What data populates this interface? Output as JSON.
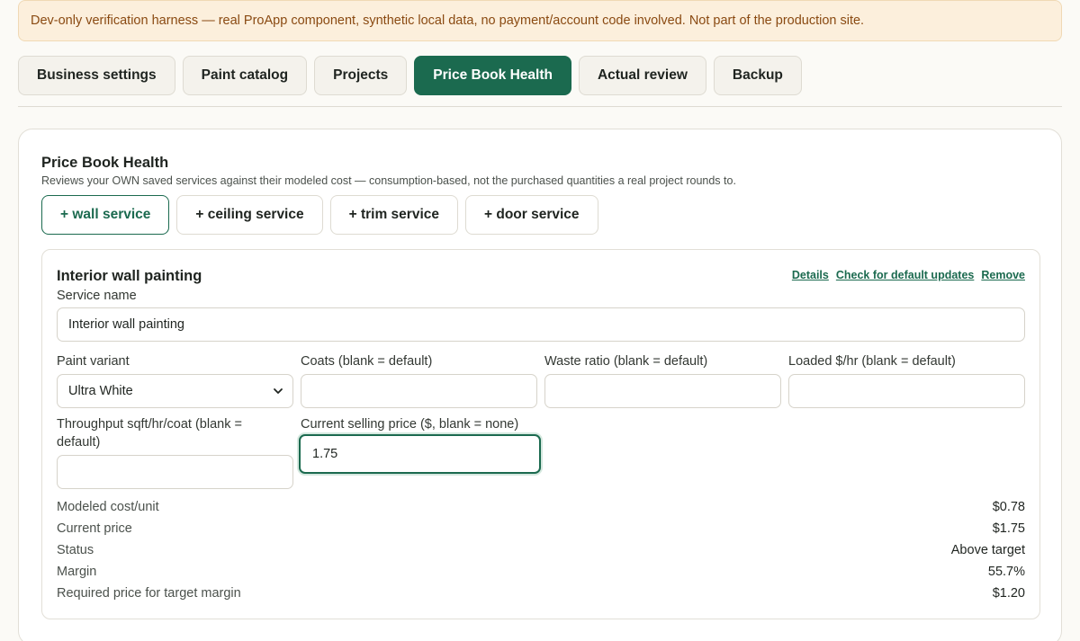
{
  "banner": {
    "text": "Dev-only verification harness — real ProApp component, synthetic local data, no payment/account code involved. Not part of the production site."
  },
  "tabs": [
    {
      "label": "Business settings",
      "active": false
    },
    {
      "label": "Paint catalog",
      "active": false
    },
    {
      "label": "Projects",
      "active": false
    },
    {
      "label": "Price Book Health",
      "active": true
    },
    {
      "label": "Actual review",
      "active": false
    },
    {
      "label": "Backup",
      "active": false
    }
  ],
  "card": {
    "title": "Price Book Health",
    "subtitle": "Reviews your OWN saved services against their modeled cost — consumption-based, not the purchased quantities a real project rounds to.",
    "add_buttons": [
      "+ wall service",
      "+ ceiling service",
      "+ trim service",
      "+ door service"
    ]
  },
  "service": {
    "title": "Interior wall painting",
    "links": {
      "details": "Details",
      "check_updates": "Check for default updates",
      "remove": "Remove"
    },
    "name_label": "Service name",
    "name_value": "Interior wall painting",
    "paint_variant_label": "Paint variant",
    "paint_variant_value": "Ultra White",
    "coats_label": "Coats (blank = default)",
    "coats_value": "",
    "waste_label": "Waste ratio (blank = default)",
    "waste_value": "",
    "loaded_label": "Loaded $/hr (blank = default)",
    "loaded_value": "",
    "throughput_label": "Throughput sqft/hr/coat (blank = default)",
    "throughput_value": "",
    "price_label": "Current selling price ($, blank = none)",
    "price_value": "1.75",
    "summary": [
      {
        "label": "Modeled cost/unit",
        "value": "$0.78"
      },
      {
        "label": "Current price",
        "value": "$1.75"
      },
      {
        "label": "Status",
        "value": "Above target"
      },
      {
        "label": "Margin",
        "value": "55.7%"
      },
      {
        "label": "Required price for target margin",
        "value": "$1.20"
      }
    ]
  },
  "colors": {
    "accent": "#1b6a4f",
    "banner_bg": "#fcefdc",
    "banner_text": "#8a4a12"
  }
}
